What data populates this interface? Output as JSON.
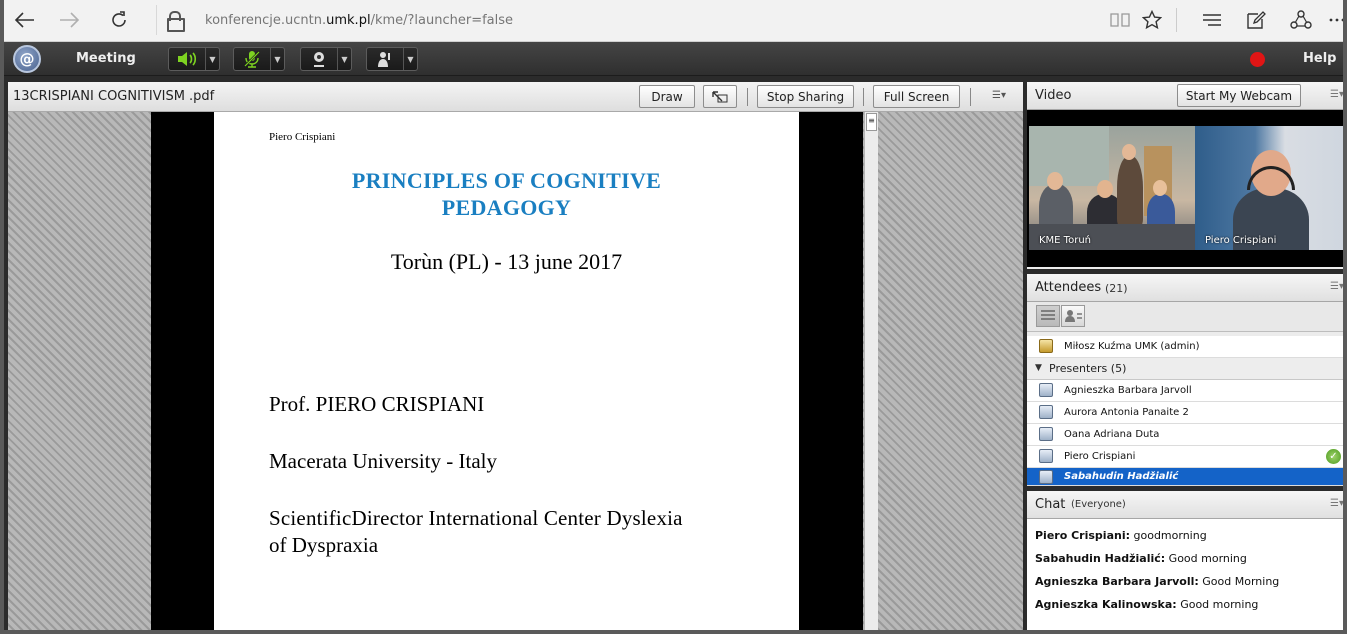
{
  "browser": {
    "url_prefix": "konferencje.ucntn.",
    "url_domain": "umk.pl",
    "url_suffix": "/kme/?launcher=false"
  },
  "menubar": {
    "logo": "@",
    "meeting_label": "Meeting",
    "help_label": "Help",
    "colors": {
      "speaker": "#7ed321",
      "mic": "#7ed321",
      "record": "#e01515"
    }
  },
  "share": {
    "file_name": "13CRISPIANI COGNITIVISM .pdf",
    "draw_label": "Draw",
    "stop_sharing_label": "Stop Sharing",
    "full_screen_label": "Full Screen"
  },
  "slide": {
    "author": "Piero Crispiani",
    "title_line1": "PRINCIPLES  OF    COGNITIVE",
    "title_line2": "PEDAGOGY",
    "date": "Torùn  (PL)  -  13 june 2017",
    "prof": "Prof.  PIERO CRISPIANI",
    "university": "Macerata  University  -  Italy",
    "director_line1": "ScientificDirector  International  Center  Dyslexia",
    "director_line2": "of  Dyspraxia",
    "title_color": "#1a7fc1"
  },
  "video": {
    "title": "Video",
    "start_webcam_label": "Start My Webcam",
    "feeds": [
      {
        "label": "KME Toruń"
      },
      {
        "label": "Piero  Crispiani"
      }
    ]
  },
  "attendees": {
    "title": "Attendees",
    "count": "(21)",
    "host": "Miłosz Kuźma UMK (admin)",
    "presenters_group": "Presenters (5)",
    "presenters": [
      {
        "name": "Agnieszka Barbara Jarvoll"
      },
      {
        "name": "Aurora Antonia Panaite 2"
      },
      {
        "name": "Oana Adriana Duta"
      },
      {
        "name": "Piero  Crispiani"
      },
      {
        "name": "Sabahudin  Hadžialić"
      }
    ]
  },
  "chat": {
    "title": "Chat",
    "scope": "(Everyone)",
    "messages": [
      {
        "from": "Piero  Crispiani:",
        "text": " goodmorning"
      },
      {
        "from": "Sabahudin  Hadžialić:",
        "text": " Good morning"
      },
      {
        "from": "Agnieszka Barbara Jarvoll:",
        "text": " Good Morning"
      },
      {
        "from": "Agnieszka Kalinowska:",
        "text": " Good morning"
      }
    ]
  }
}
